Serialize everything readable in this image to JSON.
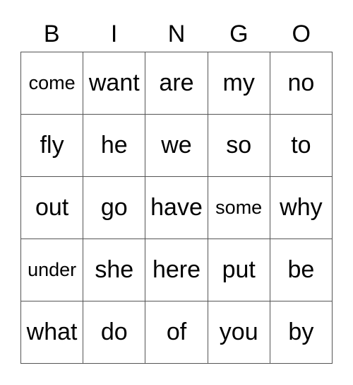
{
  "header": {
    "letters": [
      "B",
      "I",
      "N",
      "G",
      "O"
    ]
  },
  "board": {
    "rows": [
      [
        "come",
        "want",
        "are",
        "my",
        "no"
      ],
      [
        "fly",
        "he",
        "we",
        "so",
        "to"
      ],
      [
        "out",
        "go",
        "have",
        "some",
        "why"
      ],
      [
        "under",
        "she",
        "here",
        "put",
        "be"
      ],
      [
        "what",
        "do",
        "of",
        "you",
        "by"
      ]
    ],
    "small_text_words": [
      "come",
      "some",
      "under"
    ]
  }
}
